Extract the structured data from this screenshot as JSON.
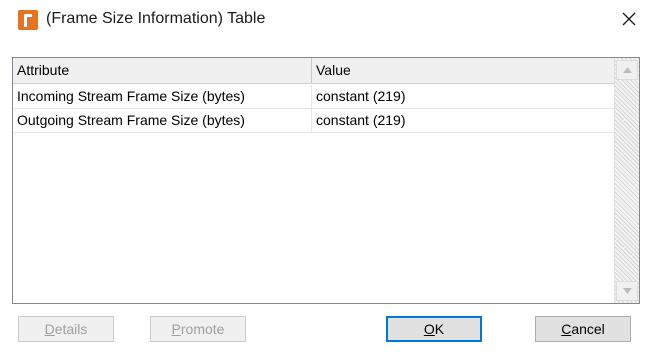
{
  "window": {
    "title": "(Frame Size Information) Table",
    "icon": "app-icon",
    "close_glyph": "close-icon"
  },
  "table": {
    "columns": [
      "Attribute",
      "Value"
    ],
    "rows": [
      {
        "attribute": "Incoming Stream Frame Size (bytes)",
        "value": "constant (219)"
      },
      {
        "attribute": "Outgoing Stream Frame Size (bytes)",
        "value": "constant (219)"
      }
    ]
  },
  "buttons": {
    "details": {
      "mnemonic": "D",
      "rest": "etails",
      "enabled": false
    },
    "promote": {
      "mnemonic": "P",
      "rest": "romote",
      "enabled": false
    },
    "ok": {
      "mnemonic": "O",
      "rest": "K",
      "enabled": true,
      "default": true
    },
    "cancel": {
      "mnemonic": "C",
      "rest": "ancel",
      "enabled": true
    }
  },
  "colors": {
    "app_icon": "#e8731e",
    "default_button_border": "#0078d7"
  }
}
